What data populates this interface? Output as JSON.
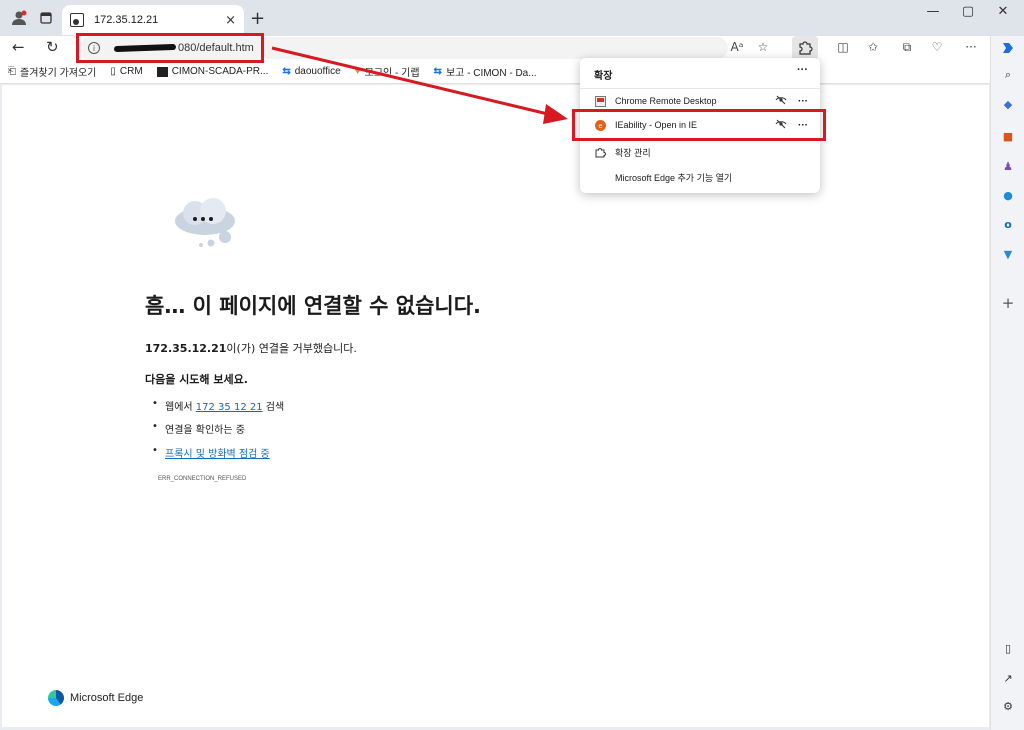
{
  "browser": {
    "tab_title": "172.35.12.21",
    "tab_close": "×",
    "new_tab": "+",
    "window_controls": [
      "—",
      "▢",
      "✕"
    ]
  },
  "address": {
    "url_suffix": "080/default.htm",
    "info_glyph": "i",
    "read_aloud": "Aᵃ"
  },
  "bookmarks": {
    "items": [
      {
        "icon": "import-icon",
        "label": "즐겨찾기 가져오기"
      },
      {
        "icon": "page-icon",
        "label": "CRM"
      },
      {
        "icon": "scada-icon",
        "label": "CIMON-SCADA-PR..."
      },
      {
        "icon": "daou-icon",
        "label": "daouoffice"
      },
      {
        "icon": "heart-icon",
        "label": "모그인 - 기랩"
      },
      {
        "icon": "daou-icon",
        "label": "보고 - CIMON - Da..."
      }
    ]
  },
  "extensions_popup": {
    "header": "확장",
    "more": "···",
    "items": [
      {
        "icon": "remote-desktop-icon",
        "label": "Chrome Remote Desktop",
        "eye": "hidden-eye-icon",
        "more": "···"
      },
      {
        "icon": "ie-icon",
        "label": "IEability - Open in IE",
        "eye": "hidden-eye-icon",
        "more": "···"
      },
      {
        "icon": "puzzle-icon",
        "label": "확장 관리"
      },
      {
        "icon": "",
        "label": "Microsoft Edge 추가 기능 열기"
      }
    ]
  },
  "error_page": {
    "title": "흠… 이 페이지에 연결할 수 없습니다.",
    "host_bold": "172.35.12.21",
    "message_rest": "이(가) 연결을 거부했습니다.",
    "try_heading": "다음을 시도해 보세요.",
    "suggestion_1_prefix": "웹에서 ",
    "suggestion_1_link": "172 35 12 21",
    "suggestion_1_suffix": " 검색",
    "suggestion_2": "연결을 확인하는 중",
    "suggestion_3_link": "프록시 및 방화벽 점검 중",
    "error_code": "ERR_CONNECTION_REFUSED",
    "brand": "Microsoft Edge"
  },
  "colors": {
    "annotation_red": "#d71921",
    "link_blue": "#0f6cbd",
    "edge_blue": "#0c59a4"
  }
}
